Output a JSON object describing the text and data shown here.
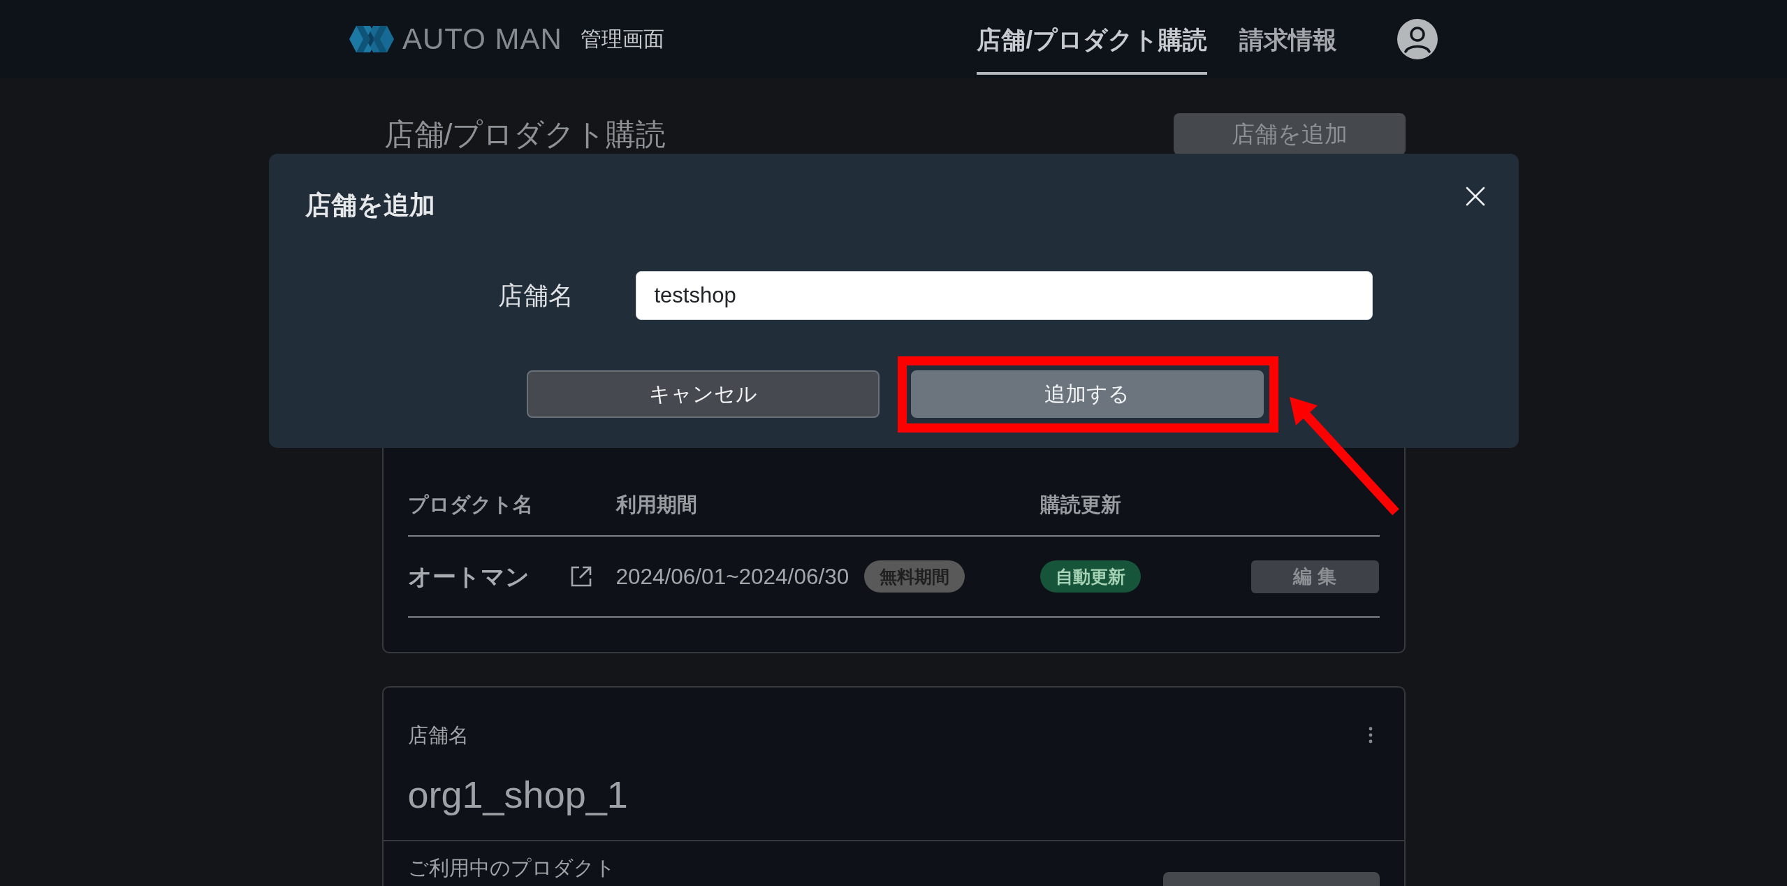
{
  "header": {
    "logo_text": "AUTO MAN",
    "subtitle": "管理画面",
    "nav": [
      {
        "label": "店舗/プロダクト購読",
        "selected": true
      },
      {
        "label": "請求情報",
        "selected": false
      }
    ]
  },
  "page": {
    "title": "店舗/プロダクト購読",
    "add_button": "店舗を追加"
  },
  "modal": {
    "title": "店舗を追加",
    "field": {
      "label": "店舗名",
      "value": "testshop"
    },
    "buttons": [
      {
        "label": "キャンセル",
        "kind": "secondary",
        "highlighted": false
      },
      {
        "label": "追加する",
        "kind": "primary",
        "highlighted": true
      }
    ]
  },
  "shop_card": {
    "table": {
      "columns": [
        "プロダクト名",
        "利用期間",
        "購読更新"
      ],
      "rows": [
        {
          "product": "オートマン",
          "period": "2024/06/01~2024/06/30",
          "period_badge": "無料期間",
          "renewal": "自動更新",
          "edit_button": "編 集"
        }
      ]
    }
  },
  "second_card": {
    "label": "店舗名",
    "name": "org1_shop_1",
    "section_title": "ご利用中のプロダクト"
  }
}
